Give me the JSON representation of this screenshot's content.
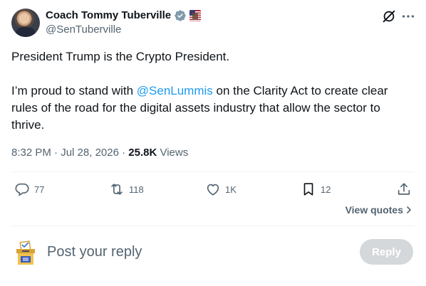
{
  "author": {
    "display_name": "Coach Tommy Tuberville",
    "handle": "@SenTuberville",
    "verified_icon": "verified-badge-icon",
    "affiliation_icon": "us-senate-flag-icon"
  },
  "tweet": {
    "paragraph1": "President Trump is the Crypto President.",
    "paragraph2_before": "I’m proud to stand with ",
    "mention": "@SenLummis",
    "paragraph2_after": " on the Clarity Act to create clear rules of the road for the digital assets industry that allow the sector to thrive."
  },
  "meta": {
    "time": "8:32 PM",
    "separator1": " · ",
    "date": "Jul 28, 2026",
    "separator2": " · ",
    "views_count": "25.8K",
    "views_label": " Views"
  },
  "actions": {
    "replies": "77",
    "reposts": "118",
    "likes": "1K",
    "bookmarks": "12",
    "view_quotes": "View quotes"
  },
  "reply_box": {
    "placeholder": "Post your reply",
    "button_label": "Reply"
  },
  "colors": {
    "accent": "#1d9bf0",
    "secondary_text": "#536471",
    "primary_text": "#0f1419",
    "divider": "#eff3f4"
  }
}
